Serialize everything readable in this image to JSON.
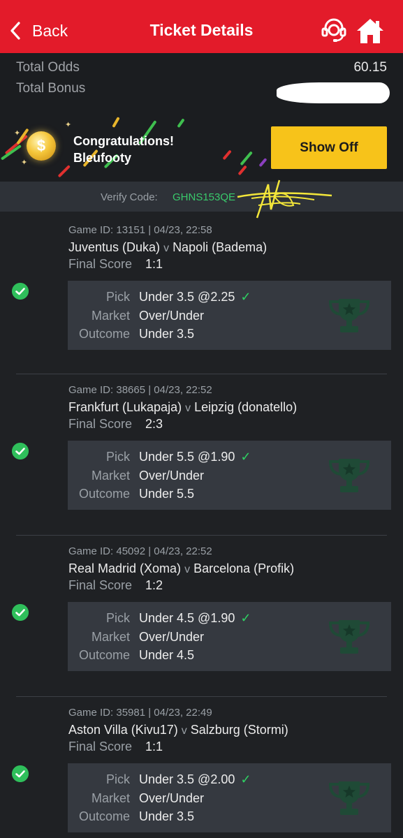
{
  "header": {
    "back_label": "Back",
    "title": "Ticket Details",
    "support_icon": "headset-icon",
    "home_icon": "home-icon",
    "bg_color": "#e31b2a"
  },
  "summary": {
    "total_odds_label": "Total Odds",
    "total_odds_value": "60.15",
    "total_bonus_label": "Total Bonus",
    "congrats_title": "Congratulations!",
    "congrats_user": "Bleufooty",
    "show_off_label": "Show Off",
    "verify_label": "Verify Code:",
    "verify_code": "GHNS153QE"
  },
  "games": [
    {
      "game_id_line": "Game ID: 13151 | 04/23, 22:58",
      "home": "Juventus (Duka)",
      "vs": "v",
      "away": "Napoli (Badema)",
      "final_score_label": "Final Score",
      "final_score": "1:1",
      "pick_label": "Pick",
      "pick": "Under 3.5 @2.25",
      "market_label": "Market",
      "market": "Over/Under",
      "outcome_label": "Outcome",
      "outcome": "Under 3.5"
    },
    {
      "game_id_line": "Game ID: 38665 | 04/23, 22:52",
      "home": "Frankfurt (Lukapaja)",
      "vs": "v",
      "away": "Leipzig (donatello)",
      "final_score_label": "Final Score",
      "final_score": "2:3",
      "pick_label": "Pick",
      "pick": "Under 5.5 @1.90",
      "market_label": "Market",
      "market": "Over/Under",
      "outcome_label": "Outcome",
      "outcome": "Under 5.5"
    },
    {
      "game_id_line": "Game ID: 45092 | 04/23, 22:52",
      "home": "Real Madrid (Xoma)",
      "vs": "v",
      "away": "Barcelona (Profik)",
      "final_score_label": "Final Score",
      "final_score": "1:2",
      "pick_label": "Pick",
      "pick": "Under 4.5 @1.90",
      "market_label": "Market",
      "market": "Over/Under",
      "outcome_label": "Outcome",
      "outcome": "Under 4.5"
    },
    {
      "game_id_line": "Game ID: 35981 | 04/23, 22:49",
      "home": "Aston Villa (Kivu17)",
      "vs": "v",
      "away": "Salzburg (Stormi)",
      "final_score_label": "Final Score",
      "final_score": "1:1",
      "pick_label": "Pick",
      "pick": "Under 3.5 @2.00",
      "market_label": "Market",
      "market": "Over/Under",
      "outcome_label": "Outcome",
      "outcome": "Under 3.5"
    }
  ]
}
